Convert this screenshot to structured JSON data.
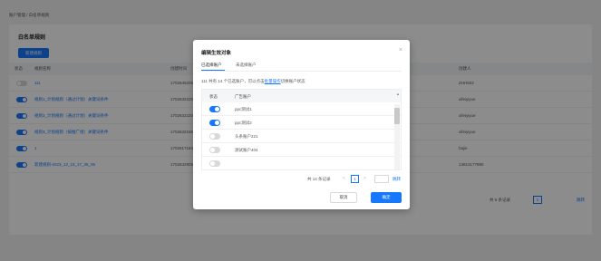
{
  "breadcrumb": "账户管理 / 白名单规则",
  "page": {
    "title": "白名单规则",
    "new_button": "新建规则",
    "columns": [
      "状态",
      "规则名称",
      "创建时间",
      "创建人"
    ],
    "rows": [
      {
        "enabled": false,
        "name": "111",
        "time": "1702645205...",
        "creator": "ZHH502"
      },
      {
        "enabled": true,
        "name": "规则1_计划规则（通过计划）关键词条件",
        "time": "1702632220...",
        "creator": "xifeiyiyue"
      },
      {
        "enabled": true,
        "name": "规则2_计划规则（通过计划）关键词条件",
        "time": "1702632220...",
        "creator": "xifeiyiyue"
      },
      {
        "enabled": true,
        "name": "规则3_计划规则（按推广组）关键词条件",
        "time": "1702632246...",
        "creator": "xifeiyiyue"
      },
      {
        "enabled": true,
        "name": "1",
        "time": "1702617184...",
        "creator": "hajie"
      },
      {
        "enabled": true,
        "name": "新建规则-2023_12_15_17_35_06",
        "time": "1702632905...",
        "creator": "13813177890"
      }
    ],
    "pager": {
      "total": "共 6 条记录",
      "page": "1",
      "jump": "跳转"
    }
  },
  "modal": {
    "title": "编辑生效对象",
    "tabs": [
      "已选择账户",
      "未选择账户"
    ],
    "hint_prefix": "111 共有 14 个已选账户，可以点击",
    "hint_link": "批量操作",
    "hint_suffix": "切换账户状态",
    "col_status": "状态",
    "col_name": "广告账户",
    "rows": [
      {
        "enabled": true,
        "name": "ppc测试1"
      },
      {
        "enabled": true,
        "name": "ppc测试2"
      },
      {
        "enabled": false,
        "name": "头条账户221"
      },
      {
        "enabled": false,
        "name": "测试账户404"
      }
    ],
    "pager": {
      "total": "共 14 条记录",
      "prev": "<",
      "page": "1",
      "next": ">",
      "jump": "跳转"
    },
    "cancel": "取消",
    "ok": "确定",
    "close": "×"
  },
  "colors": {
    "accent": "#1677ff"
  }
}
